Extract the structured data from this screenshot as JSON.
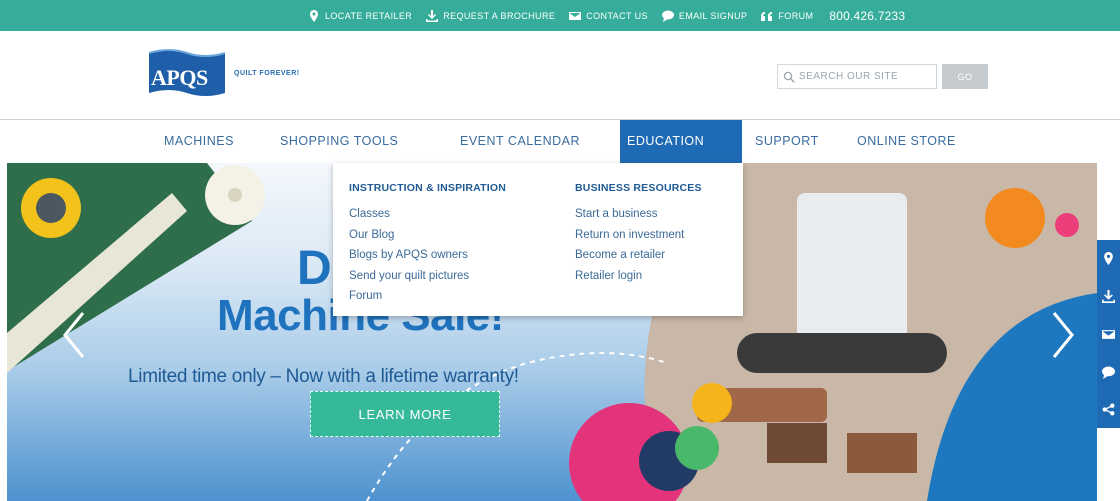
{
  "topbar": {
    "links": [
      {
        "label": "LOCATE RETAILER",
        "icon": "map-pin-icon"
      },
      {
        "label": "REQUEST A BROCHURE",
        "icon": "download-icon"
      },
      {
        "label": "CONTACT US",
        "icon": "envelope-icon"
      },
      {
        "label": "EMAIL SIGNUP",
        "icon": "chat-bubble-icon"
      },
      {
        "label": "FORUM",
        "icon": "quote-icon"
      }
    ],
    "phone": "800.426.7233"
  },
  "header": {
    "logo_text": "APQS",
    "tagline": "QUILT FOREVER!",
    "search_placeholder": "SEARCH OUR SITE",
    "go_label": "GO"
  },
  "nav": {
    "items": [
      "MACHINES",
      "SHOPPING TOOLS",
      "EVENT CALENDAR",
      "EDUCATION",
      "SUPPORT",
      "ONLINE STORE"
    ],
    "active": "EDUCATION"
  },
  "dropdown": {
    "col1_head": "INSTRUCTION & INSPIRATION",
    "col1_links": [
      "Classes",
      "Our Blog",
      "Blogs by APQS owners",
      "Send your quilt pictures",
      "Forum"
    ],
    "col2_head": "BUSINESS RESOURCES",
    "col2_links": [
      "Start a business",
      "Return on investment",
      "Become a retailer",
      "Retailer login"
    ]
  },
  "hero": {
    "headline_part1": "D",
    "headline_part2": "Machine Sale!",
    "subline": "Limited time only – Now with a lifetime warranty!",
    "cta": "LEARN MORE"
  },
  "colors": {
    "topbar": "#35ad9a",
    "nav_text": "#3a6c9f",
    "nav_active": "#1f6ab4",
    "headline": "#1f72bd",
    "cta": "#36b89a"
  },
  "side_icons": [
    "map-pin-icon",
    "download-icon",
    "envelope-icon",
    "chat-bubble-icon",
    "share-icon"
  ]
}
